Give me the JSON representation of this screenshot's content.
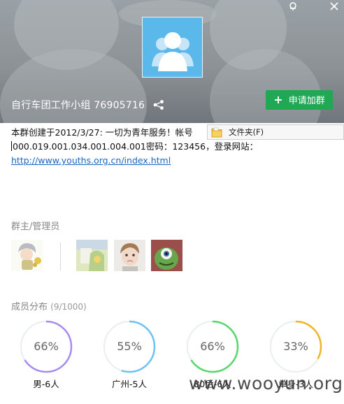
{
  "window": {
    "pin_icon": "pin-icon",
    "close_icon": "close-icon"
  },
  "group": {
    "title": "自行车团工作小组 76905716",
    "share_icon": "share-icon",
    "join_label": "申请加群",
    "join_color": "#21a855"
  },
  "description": {
    "line1": "本群创建于2012/3/27:  一切为青年服务！帐号",
    "line2": "000.019.001.034.001.004.001密码：123456，登录网站：",
    "link": "http://www.youths.org.cn/index.html"
  },
  "tooltip": {
    "label": "文件夹(F)",
    "icon": "folder-icon"
  },
  "admins": {
    "title": "群主/管理员",
    "count": 4
  },
  "members": {
    "title": "成员分布",
    "count": "(9/1000)",
    "stats": [
      {
        "label": "男-6人",
        "percent": 66,
        "display": "66%",
        "color": "#a78bf0"
      },
      {
        "label": "广州-5人",
        "percent": 55,
        "display": "55%",
        "color": "#6cc2f0"
      },
      {
        "label": "80后-6人",
        "percent": 66,
        "display": "66%",
        "color": "#55d76a"
      },
      {
        "label": "单身-3人",
        "percent": 33,
        "display": "33%",
        "color": "#f0b42a"
      }
    ]
  },
  "watermark": "www.wooyun.org"
}
